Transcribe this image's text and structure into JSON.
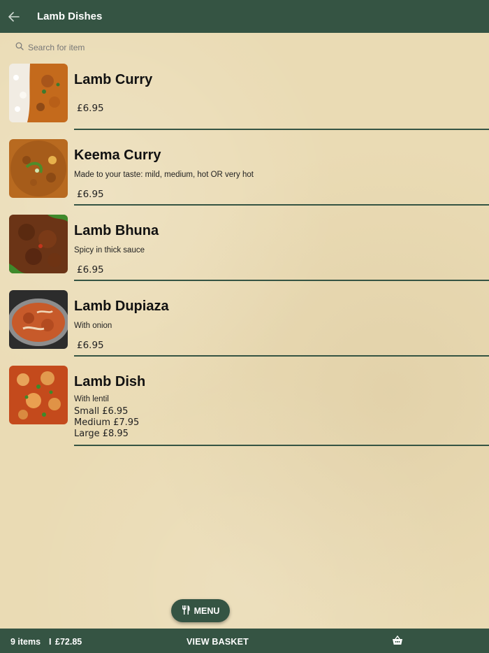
{
  "header": {
    "title": "Lamb Dishes",
    "back_icon": "arrow-left-icon"
  },
  "search": {
    "placeholder": "Search for item",
    "icon": "search-icon"
  },
  "items": [
    {
      "name": "Lamb Curry",
      "description": "",
      "price": "£6.95",
      "image": "lamb-curry-photo"
    },
    {
      "name": "Keema Curry",
      "description": "Made to your taste: mild, medium, hot OR very hot",
      "price": "£6.95",
      "image": "keema-curry-photo"
    },
    {
      "name": "Lamb Bhuna",
      "description": "Spicy in thick sauce",
      "price": "£6.95",
      "image": "lamb-bhuna-photo"
    },
    {
      "name": "Lamb Dupiaza",
      "description": "With onion",
      "price": "£6.95",
      "image": "lamb-dupiaza-photo"
    },
    {
      "name": "Lamb Dish",
      "description": "With lentil",
      "sizes": [
        "Small £6.95",
        "Medium £7.95",
        "Large £8.95"
      ],
      "image": "lamb-dish-photo"
    }
  ],
  "menu_button": {
    "label": "MENU",
    "icon": "fork-knife-icon"
  },
  "footer": {
    "items_count": "9 items",
    "separator": "I",
    "total": "£72.85",
    "view_basket": "VIEW BASKET",
    "basket_icon": "basket-icon"
  },
  "colors": {
    "primary": "#355443",
    "background": "#eadbb4"
  }
}
